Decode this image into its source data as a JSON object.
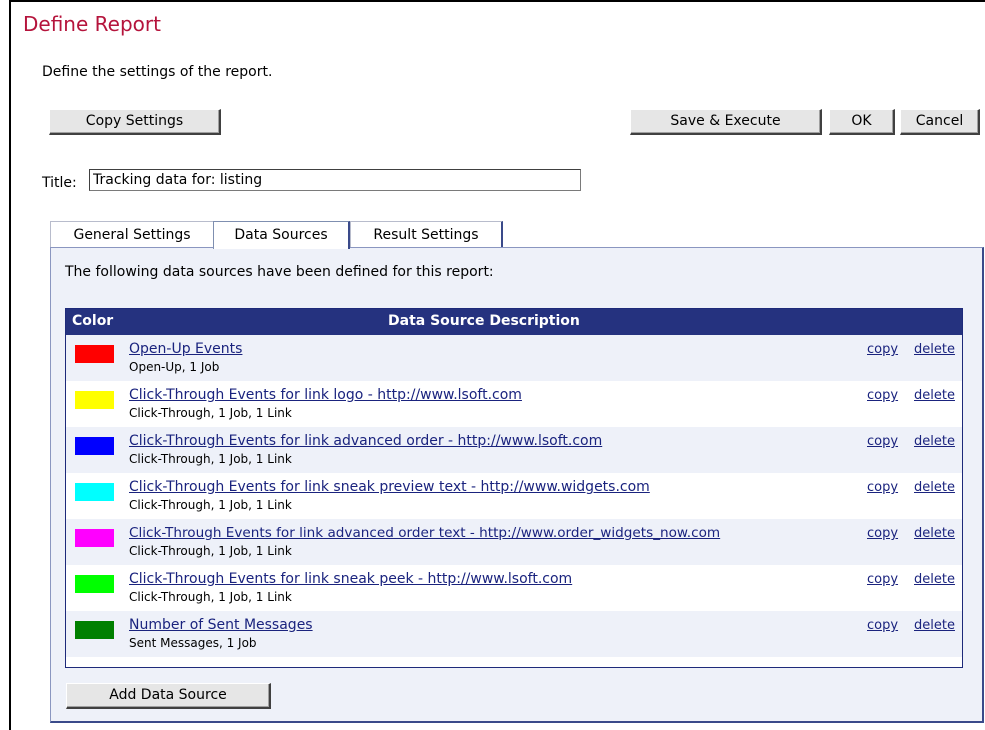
{
  "page": {
    "title": "Define Report",
    "subtitle": "Define the settings of the report."
  },
  "toolbar": {
    "copy_settings": "Copy Settings",
    "save_execute": "Save & Execute",
    "ok": "OK",
    "cancel": "Cancel"
  },
  "title_field": {
    "label": "Title:",
    "value": "Tracking data for: listing"
  },
  "tabs": [
    {
      "label": "General Settings",
      "active": false
    },
    {
      "label": "Data Sources",
      "active": true
    },
    {
      "label": "Result Settings",
      "active": false
    }
  ],
  "data_sources": {
    "intro": "The following data sources have been defined for this report:",
    "header_color": "Color",
    "header_description": "Data Source Description",
    "copy_label": "copy",
    "delete_label": "delete",
    "rows": [
      {
        "color": "#ff0000",
        "title": "Open-Up Events",
        "details": "Open-Up, 1 Job"
      },
      {
        "color": "#ffff00",
        "title": "Click-Through Events for link logo - http://www.lsoft.com",
        "details": "Click-Through, 1 Job, 1 Link"
      },
      {
        "color": "#0000ff",
        "title": "Click-Through Events for link advanced order - http://www.lsoft.com",
        "details": "Click-Through, 1 Job, 1 Link"
      },
      {
        "color": "#00ffff",
        "title": "Click-Through Events for link sneak preview text - http://www.widgets.com",
        "details": "Click-Through, 1 Job, 1 Link"
      },
      {
        "color": "#ff00ff",
        "title": "Click-Through Events for link advanced order text - http://www.order_widgets_now.com",
        "details": "Click-Through, 1 Job, 1 Link"
      },
      {
        "color": "#00ff00",
        "title": "Click-Through Events for link sneak peek - http://www.lsoft.com",
        "details": "Click-Through, 1 Job, 1 Link"
      },
      {
        "color": "#008000",
        "title": "Number of Sent Messages",
        "details": "Sent Messages, 1 Job"
      }
    ],
    "add_button": "Add Data Source"
  }
}
